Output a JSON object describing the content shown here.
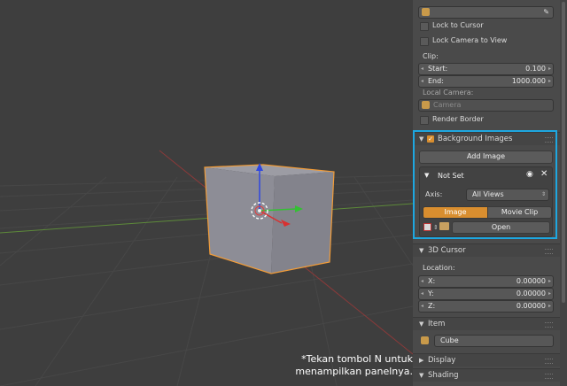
{
  "caption": {
    "line1": "*Tekan  tombol N untuk",
    "line2": "menampilkan panelnya."
  },
  "view": {
    "lock_to_cursor": "Lock to Cursor",
    "lock_camera_to_view": "Lock Camera to View",
    "clip_label": "Clip:",
    "start_label": "Start:",
    "start_value": "0.100",
    "end_label": "End:",
    "end_value": "1000.000",
    "local_camera_label": "Local Camera:",
    "camera_placeholder": "Camera",
    "render_border": "Render Border"
  },
  "background_images": {
    "title": "Background Images",
    "add_image": "Add Image",
    "item_title": "Not Set",
    "axis_label": "Axis:",
    "axis_value": "All Views",
    "tab_image": "Image",
    "tab_movie_clip": "Movie Clip",
    "open_button": "Open"
  },
  "cursor_3d": {
    "title": "3D Cursor",
    "location_label": "Location:",
    "x_label": "X:",
    "x_value": "0.00000",
    "y_label": "Y:",
    "y_value": "0.00000",
    "z_label": "Z:",
    "z_value": "0.00000"
  },
  "item": {
    "title": "Item",
    "name": "Cube"
  },
  "display": {
    "title": "Display"
  },
  "shading": {
    "title": "Shading"
  },
  "colors": {
    "highlight": "#1ea7e0",
    "active_tab": "#d98e2f",
    "selection": "#f29c38"
  }
}
